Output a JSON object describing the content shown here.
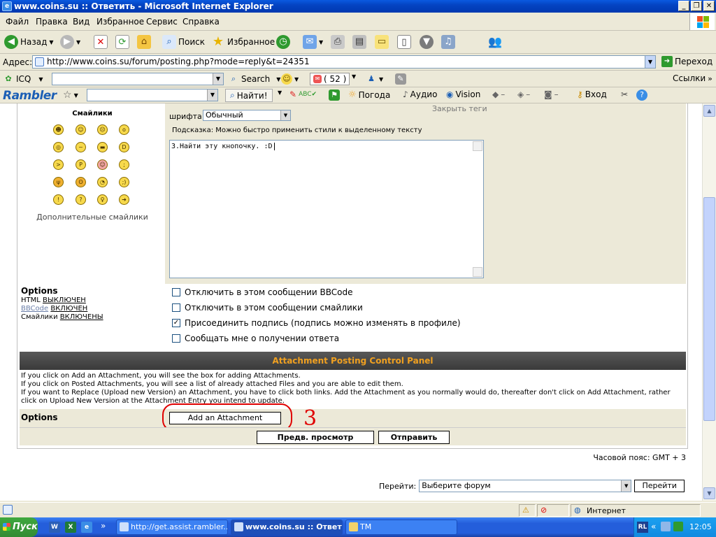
{
  "window": {
    "title": "www.coins.su :: Ответить - Microsoft Internet Explorer"
  },
  "menu": {
    "items": [
      "Файл",
      "Правка",
      "Вид",
      "Избранное",
      "Сервис",
      "Справка"
    ]
  },
  "toolbar": {
    "back": "Назад",
    "search": "Поиск",
    "favorites": "Избранное"
  },
  "address": {
    "label": "Адрес:",
    "url": "http://www.coins.su/forum/posting.php?mode=reply&t=24351",
    "go": "Переход"
  },
  "icq_bar": {
    "icq": "ICQ",
    "search": "Search",
    "count": "( 52 )",
    "links": "Ссылки"
  },
  "rambler_bar": {
    "logo": "Rambler",
    "find": "Найти!",
    "weather": "Погода",
    "audio": "Аудио",
    "vision": "Vision",
    "login": "Вход"
  },
  "smilies": {
    "title": "Смайлики",
    "more": "Дополнительные смайлики"
  },
  "editor": {
    "font_label": "шрифта:",
    "font_value": "Обычный",
    "close_tags": "Закрыть теги",
    "hint": "Подсказка: Можно быстро применить стили к выделенному тексту",
    "message": "3.Найти эту кнопочку. :D"
  },
  "options": {
    "title": "Options",
    "html_label": "HTML",
    "html_state": "ВЫКЛЮЧЕН",
    "bbcode_label": "BBCode",
    "bbcode_state": "ВКЛЮЧЕН",
    "smilies_label": "Смайлики",
    "smilies_state": "ВКЛЮЧЕНЫ",
    "checkboxes": [
      {
        "label": "Отключить в этом сообщении BBCode",
        "checked": false
      },
      {
        "label": "Отключить в этом сообщении смайлики",
        "checked": false
      },
      {
        "label": "Присоединить подпись (подпись можно изменять в профиле)",
        "checked": true
      },
      {
        "label": "Сообщать мне о получении ответа",
        "checked": false
      }
    ]
  },
  "attachment": {
    "header": "Attachment Posting Control Panel",
    "info": [
      "If you click on Add an Attachment, you will see the box for adding Attachments.",
      "If you click on Posted Attachments, you will see a list of already attached Files and you are able to edit them.",
      "If you want to Replace (Upload new Version) an Attachment, you have to click both links. Add the Attachment as you normally would do, thereafter don't click on Add Attachment, rather click on Upload New Version at the Attachment Entry you intend to update."
    ],
    "options_label": "Options",
    "add_button": "Add an Attachment",
    "annotation": "3"
  },
  "buttons": {
    "preview": "Предв. просмотр",
    "submit": "Отправить"
  },
  "footer": {
    "timezone": "Часовой пояс: GMT + 3",
    "jump_label": "Перейти:",
    "jump_select": "Выберите форум",
    "jump_button": "Перейти"
  },
  "status": {
    "zone": "Интернет"
  },
  "taskbar": {
    "start": "Пуск",
    "tasks": [
      "http://get.assist.rambler...",
      "www.coins.su :: Ответ...",
      "TM"
    ],
    "lang": "RL",
    "clock": "12:05"
  }
}
